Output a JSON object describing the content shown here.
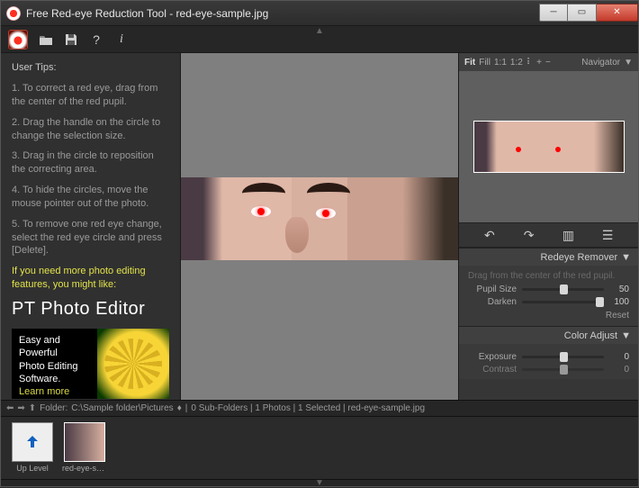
{
  "window": {
    "title": "Free Red-eye Reduction Tool - red-eye-sample.jpg"
  },
  "tips": {
    "heading": "User Tips:",
    "items": [
      "1. To correct a red eye, drag from the center of the red pupil.",
      "2. Drag the handle on the circle to change the selection size.",
      "3. Drag in the circle to reposition the correcting area.",
      "4. To hide the circles, move the mouse pointer out of the photo.",
      "5. To remove one red eye change, select the red eye circle and press [Delete]."
    ]
  },
  "promo": {
    "lead": "If you need more photo editing features, you might like:",
    "title": "PT Photo Editor",
    "box_line1": "Easy and",
    "box_line2": "Powerful",
    "box_line3": "Photo Editing",
    "box_line4": "Software.",
    "learn_more": "Learn more"
  },
  "navigator": {
    "title": "Navigator",
    "fit": "Fit",
    "fill": "Fill",
    "ratio1": "1:1",
    "ratio2": "1:2",
    "dots": "⠇",
    "plus": "+",
    "minus": "−"
  },
  "redeye_panel": {
    "title": "Redeye Remover",
    "hint": "Drag from the center of the red pupil.",
    "pupil_label": "Pupil Size",
    "pupil_value": "50",
    "darken_label": "Darken",
    "darken_value": "100",
    "reset": "Reset"
  },
  "color_panel": {
    "title": "Color Adjust",
    "exposure_label": "Exposure",
    "exposure_value": "0",
    "contrast_label": "Contrast",
    "contrast_value": "0"
  },
  "status": {
    "folder_label": "Folder:",
    "path": "C:\\Sample folder\\Pictures",
    "counts": "0 Sub-Folders | 1 Photos | 1 Selected | red-eye-sample.jpg"
  },
  "strip": {
    "up_level": "Up Level",
    "thumb_name": "red-eye-sa..."
  },
  "icons": {
    "open": "open-folder-icon",
    "save": "save-icon",
    "help": "help-icon",
    "info": "info-icon",
    "rotate_ccw": "rotate-ccw-icon",
    "rotate_cw": "rotate-cw-icon",
    "flip_h": "flip-horizontal-icon",
    "flip_v": "flip-vertical-icon"
  }
}
